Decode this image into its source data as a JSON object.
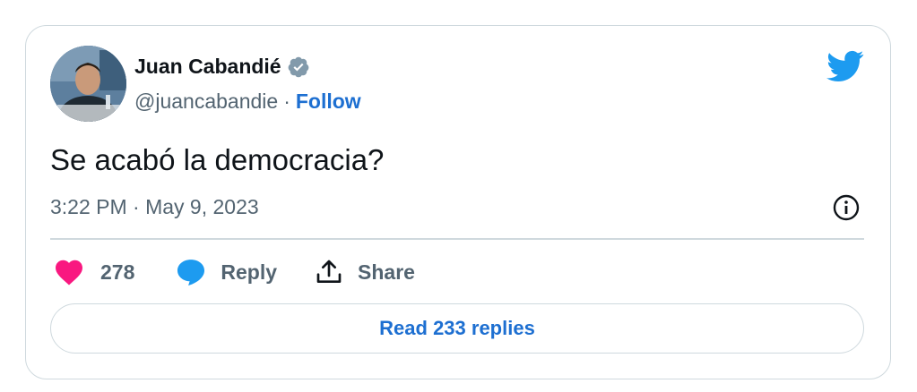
{
  "author": {
    "name": "Juan Cabandié",
    "handle": "@juancabandie",
    "separator": "·",
    "follow_label": "Follow"
  },
  "tweet": {
    "text": "Se acabó la democracia?",
    "timestamp": "3:22 PM · May 9, 2023"
  },
  "actions": {
    "like_count": "278",
    "reply_label": "Reply",
    "share_label": "Share"
  },
  "read_replies_label": "Read 233 replies",
  "colors": {
    "brand_blue": "#1d9bf0",
    "link_blue": "#1d6fd1",
    "like_pink": "#f91880",
    "muted_gray": "#536471",
    "border_gray": "#cfd9de"
  },
  "icons": [
    "verified-badge-icon",
    "twitter-bird-icon",
    "info-icon",
    "heart-icon",
    "reply-bubble-icon",
    "share-icon"
  ]
}
